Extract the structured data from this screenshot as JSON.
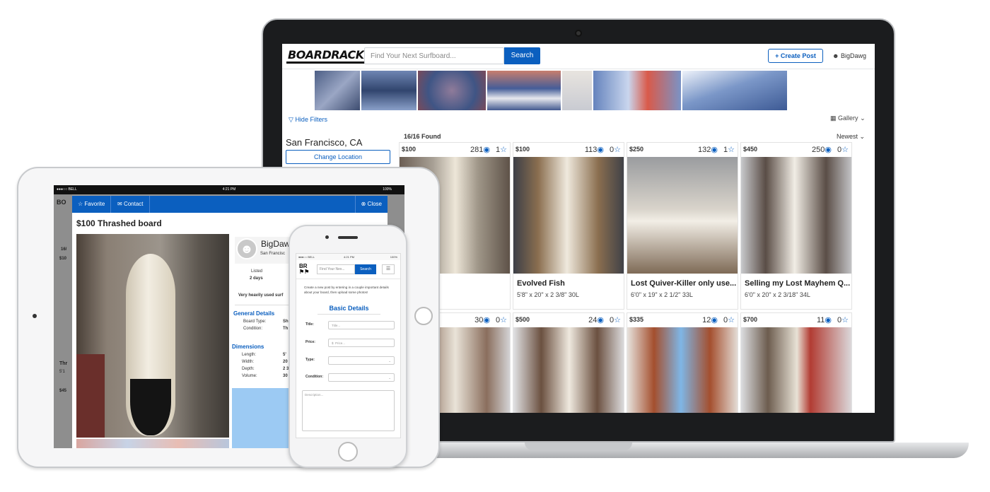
{
  "laptop": {
    "logo": "BOARDRACK",
    "search_placeholder": "Find Your Next Surfboard...",
    "search_button": "Search",
    "create_post": "+ Create Post",
    "user_name": "BigDawg",
    "hide_filters": "Hide Filters",
    "gallery": "Gallery",
    "location": "San Francisco, CA",
    "change_location": "Change Location",
    "found": "16/16 Found",
    "sort": "Newest",
    "cards": [
      {
        "price": "$100",
        "views": "281",
        "favs": "1",
        "title": "board",
        "dims": "2 3/8\"   30L"
      },
      {
        "price": "$100",
        "views": "113",
        "favs": "0",
        "title": "Evolved Fish",
        "dims": "5'8\" x 20\" x 2 3/8\"   30L"
      },
      {
        "price": "$250",
        "views": "132",
        "favs": "1",
        "title": "Lost Quiver-Killer only use...",
        "dims": "6'0\" x 19\" x 2 1/2\"   33L"
      },
      {
        "price": "$450",
        "views": "250",
        "favs": "0",
        "title": "Selling my Lost Mayhem Q...",
        "dims": "6'0\" x 20\" x 2 3/18\"   34L"
      },
      {
        "price": "",
        "views": "30",
        "favs": "0",
        "title": "",
        "dims": ""
      },
      {
        "price": "$500",
        "views": "24",
        "favs": "0",
        "title": "",
        "dims": ""
      },
      {
        "price": "$335",
        "views": "12",
        "favs": "0",
        "title": "",
        "dims": ""
      },
      {
        "price": "$700",
        "views": "11",
        "favs": "0",
        "title": "",
        "dims": ""
      }
    ]
  },
  "tablet": {
    "status_carrier": "●●●○○ BELL",
    "status_time": "4:21 PM",
    "status_battery": "100%",
    "favorite": "Favorite",
    "contact": "Contact",
    "close": "Close",
    "title": "$100 Thrashed board",
    "seller": "BigDaw",
    "seller_sub": "San Francisc",
    "listed_label": "Listed",
    "listed_value": "2 days",
    "note": "Very heavily used surf",
    "general_details": "General Details",
    "board_type_label": "Board Type:",
    "board_type_value": "Sh",
    "condition_label": "Condition:",
    "condition_value": "Th",
    "dimensions": "Dimensions",
    "length_label": "Length:",
    "length_value": "5' ",
    "width_label": "Width:",
    "width_value": "20",
    "depth_label": "Depth:",
    "depth_value": "2 3",
    "volume_label": "Volume:",
    "volume_value": "30",
    "bg_found": "16/",
    "bg_price1": "$10",
    "bg_title": "Thr",
    "bg_dims": "5'1",
    "bg_price2": "$45"
  },
  "phone": {
    "status_carrier": "●●●○○ BELL",
    "status_time": "4:21 PM",
    "status_battery": "100%",
    "search_placeholder": "Find Your Nex...",
    "search_button": "Search",
    "menu": "☰",
    "intro": "Create a new post by entering in a couple important details about your board, then upload some photos!",
    "basic_details": "Basic Details",
    "title_label": "Title:",
    "title_placeholder": "Title...",
    "price_label": "Price:",
    "price_prefix": "$",
    "price_placeholder": "Price...",
    "type_label": "Type:",
    "condition_label": "Condition:",
    "description_placeholder": "Description..."
  }
}
